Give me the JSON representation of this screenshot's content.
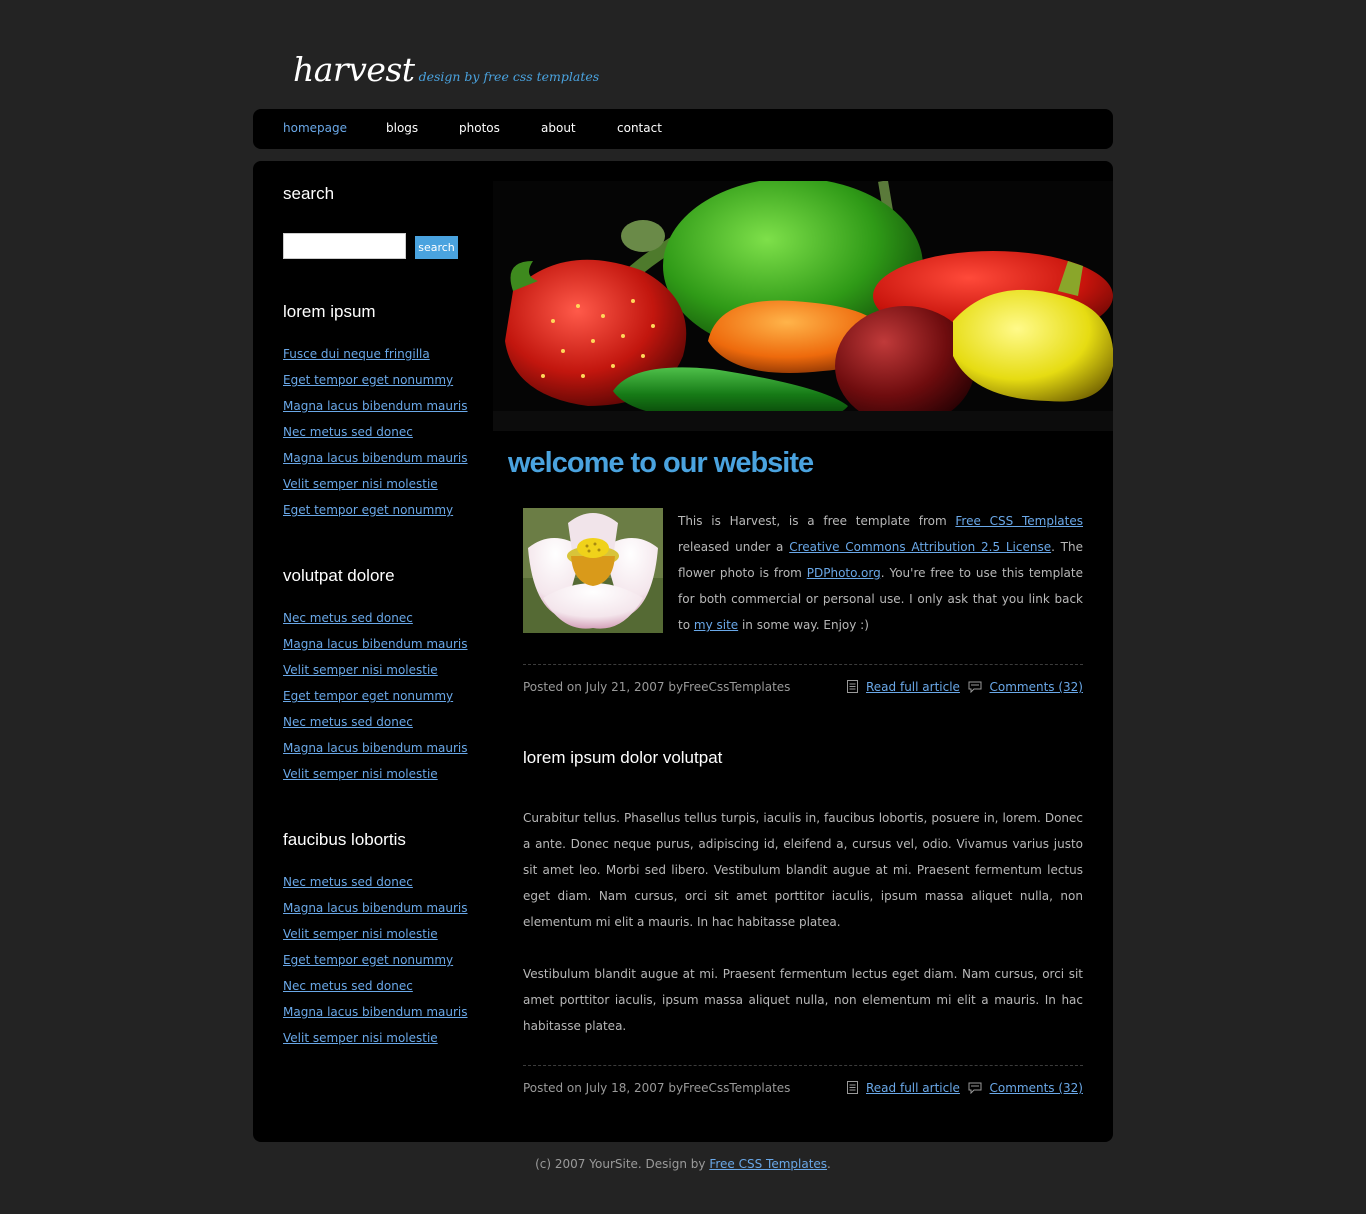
{
  "header": {
    "logo_title": "harvest",
    "tagline": "design by free css templates"
  },
  "nav": {
    "items": [
      {
        "label": "homepage",
        "current": true
      },
      {
        "label": "blogs"
      },
      {
        "label": "photos"
      },
      {
        "label": "about"
      },
      {
        "label": "contact"
      }
    ]
  },
  "sidebar": {
    "search": {
      "heading": "search",
      "button_label": "search",
      "input_value": ""
    },
    "sections": [
      {
        "heading": "lorem ipsum",
        "links": [
          "Fusce dui neque fringilla",
          "Eget tempor eget nonummy",
          "Magna lacus bibendum mauris",
          "Nec metus sed donec",
          "Magna lacus bibendum mauris",
          "Velit semper nisi molestie",
          "Eget tempor eget nonummy"
        ]
      },
      {
        "heading": "volutpat dolore",
        "links": [
          "Nec metus sed donec",
          "Magna lacus bibendum mauris",
          "Velit semper nisi molestie",
          "Eget tempor eget nonummy",
          "Nec metus sed donec",
          "Magna lacus bibendum mauris",
          "Velit semper nisi molestie"
        ]
      },
      {
        "heading": "faucibus lobortis",
        "links": [
          "Nec metus sed donec",
          "Magna lacus bibendum mauris",
          "Velit semper nisi molestie",
          "Eget tempor eget nonummy",
          "Nec metus sed donec",
          "Magna lacus bibendum mauris",
          "Velit semper nisi molestie"
        ]
      }
    ]
  },
  "main": {
    "welcome_title": "welcome to our website",
    "post1": {
      "text_1": "This is Harvest, is a free template from ",
      "link_1": "Free CSS Templates",
      "text_2": " released under a ",
      "link_2": "Creative Commons Attribution 2.5 License",
      "text_3": ". The flower photo is from ",
      "link_3": "PDPhoto.org",
      "text_4": ". You're free to use this template for both commercial or personal use. I only ask that you link back to ",
      "link_4": "my site",
      "text_5": " in some way. Enjoy :)",
      "meta": {
        "posted": "Posted on July 21, 2007 byFreeCssTemplates",
        "read_more": "Read full article",
        "comments": "Comments (32)"
      }
    },
    "post2": {
      "title": "lorem ipsum dolor volutpat",
      "para_1": "Curabitur tellus. Phasellus tellus turpis, iaculis in, faucibus lobortis, posuere in, lorem. Donec a ante. Donec neque purus, adipiscing id, eleifend a, cursus vel, odio. Vivamus varius justo sit amet leo. Morbi sed libero. Vestibulum blandit augue at mi. Praesent fermentum lectus eget diam. Nam cursus, orci sit amet porttitor iaculis, ipsum massa aliquet nulla, non elementum mi elit a mauris. In hac habitasse platea.",
      "para_2": "Vestibulum blandit augue at mi. Praesent fermentum lectus eget diam. Nam cursus, orci sit amet porttitor iaculis, ipsum massa aliquet nulla, non elementum mi elit a mauris. In hac habitasse platea.",
      "meta": {
        "posted": "Posted on July 18, 2007 byFreeCssTemplates",
        "read_more": "Read full article",
        "comments": "Comments (32)"
      }
    }
  },
  "footer": {
    "text": "(c) 2007 YourSite. Design by ",
    "link": "Free CSS Templates",
    "end": "."
  },
  "colors": {
    "background": "#232323",
    "panel": "#000000",
    "accent": "#4aa3df",
    "link": "#6aa8e8"
  },
  "icons": {
    "read_more": "document-icon",
    "comments": "speech-bubble-icon"
  }
}
